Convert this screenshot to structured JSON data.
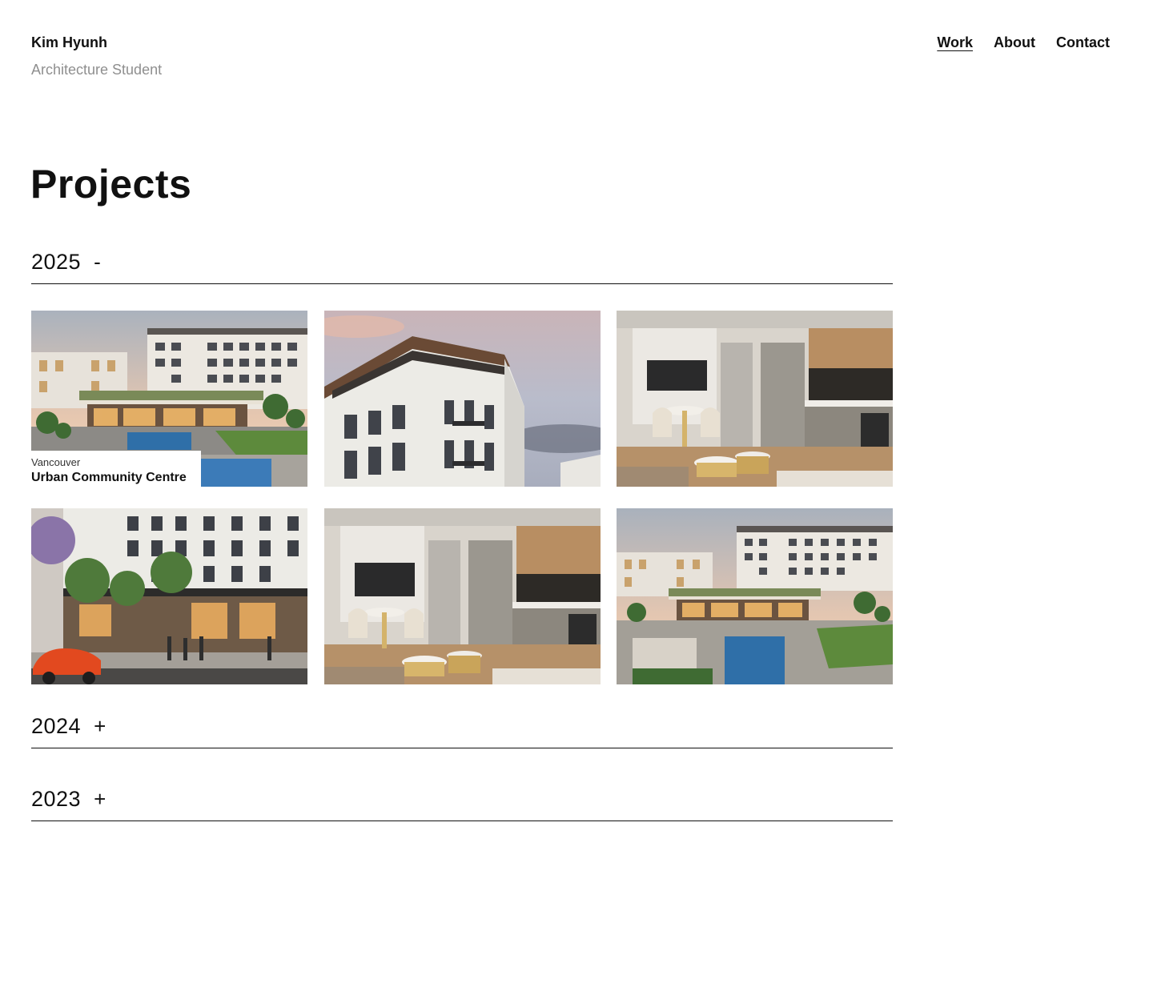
{
  "brand": {
    "name": "Kim Hyunh",
    "role": "Architecture Student"
  },
  "nav": {
    "work": "Work",
    "about": "About",
    "contact": "Contact",
    "active": "Work"
  },
  "page": {
    "title": "Projects"
  },
  "sections": [
    {
      "year": "2025",
      "toggle": "-",
      "expanded": true
    },
    {
      "year": "2024",
      "toggle": "+",
      "expanded": false
    },
    {
      "year": "2023",
      "toggle": "+",
      "expanded": false
    }
  ],
  "projects": [
    {
      "image": "courtyard-exterior-rendering",
      "city": "Vancouver",
      "title": "Urban Community Centre"
    },
    {
      "image": "building-corner-rendering"
    },
    {
      "image": "apartment-interior-rendering"
    },
    {
      "image": "street-view-rendering"
    },
    {
      "image": "apartment-interior-rendering"
    },
    {
      "image": "courtyard-exterior-rendering"
    }
  ],
  "colors": {
    "text": "#111111",
    "muted": "#8f8f8f",
    "background": "#ffffff",
    "rule": "#111111"
  }
}
